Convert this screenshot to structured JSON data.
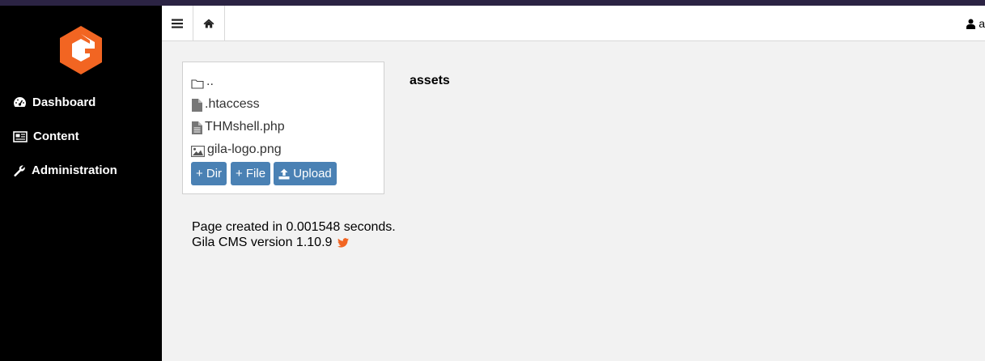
{
  "sidebar": {
    "items": [
      {
        "label": "Dashboard",
        "icon": "dashboard-icon"
      },
      {
        "label": "Content",
        "icon": "newspaper-icon"
      },
      {
        "label": "Administration",
        "icon": "wrench-icon"
      }
    ]
  },
  "topbar": {
    "user_label": "a"
  },
  "filebrowser": {
    "files": [
      {
        "name": "..",
        "icon": "folder-icon"
      },
      {
        "name": ".htaccess",
        "icon": "file-icon"
      },
      {
        "name": "THMshell.php",
        "icon": "file-text-icon"
      },
      {
        "name": "gila-logo.png",
        "icon": "image-icon"
      }
    ],
    "buttons": {
      "dir": "+ Dir",
      "file": "+ File",
      "upload": "Upload"
    },
    "folder_title": "assets"
  },
  "footer": {
    "line1": "Page created in 0.001548 seconds.",
    "line2": "Gila CMS version 1.10.9"
  },
  "colors": {
    "brand_orange": "#f26522",
    "button_blue": "#4a81b4",
    "sidebar_bg": "#000000"
  }
}
